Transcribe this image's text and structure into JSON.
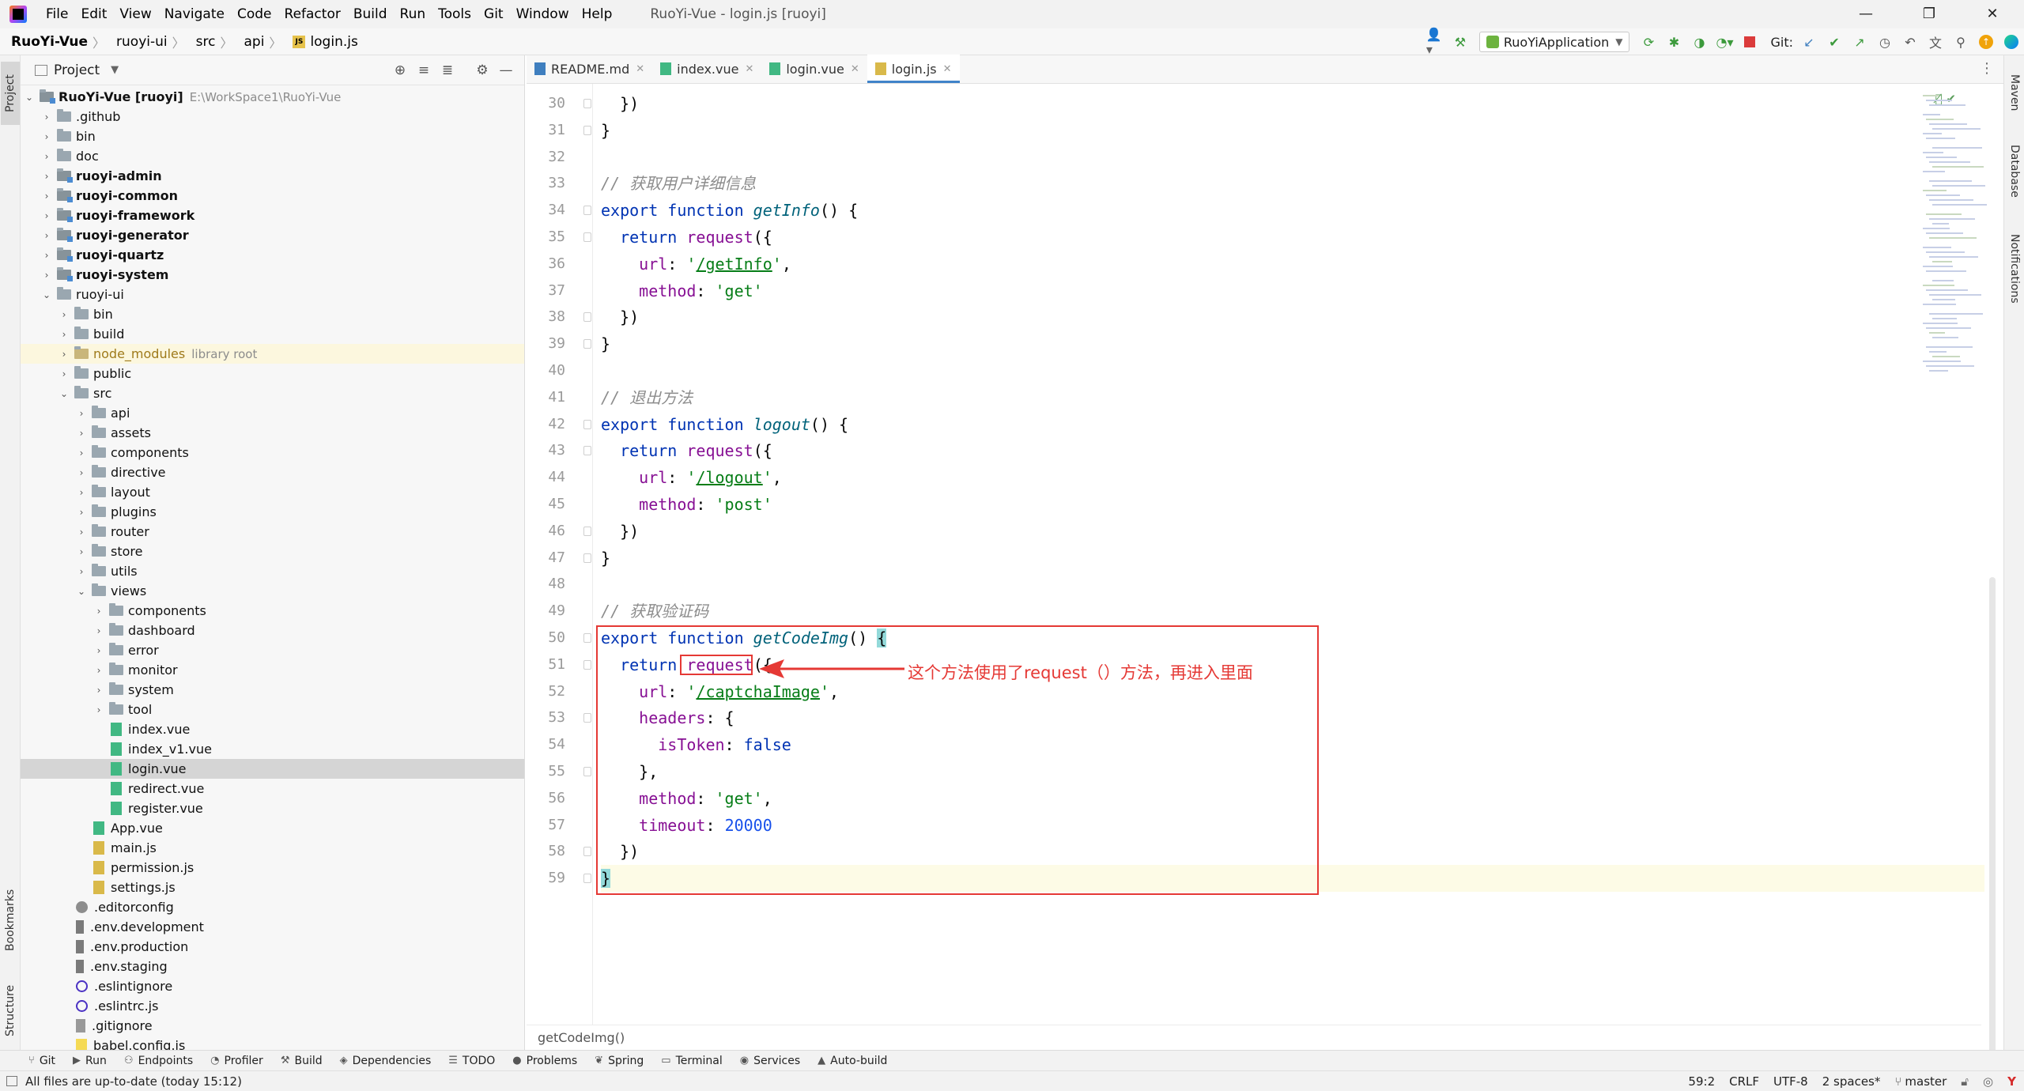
{
  "window": {
    "title": "RuoYi-Vue - login.js [ruoyi]",
    "menu": [
      "File",
      "Edit",
      "View",
      "Navigate",
      "Code",
      "Refactor",
      "Build",
      "Run",
      "Tools",
      "Git",
      "Window",
      "Help"
    ],
    "controls": {
      "minimize": "—",
      "restore": "❐",
      "close": "✕"
    }
  },
  "breadcrumb": [
    "RuoYi-Vue",
    "ruoyi-ui",
    "src",
    "api",
    "login.js"
  ],
  "toolbar": {
    "run_config": "RuoYiApplication",
    "git_label": "Git:"
  },
  "project_panel": {
    "title": "Project",
    "root": {
      "label": "RuoYi-Vue [ruoyi]",
      "path": "E:\\WorkSpace1\\RuoYi-Vue"
    },
    "items": [
      {
        "label": ".github",
        "kind": "folder",
        "depth": 1,
        "arrow": "›"
      },
      {
        "label": "bin",
        "kind": "folder",
        "depth": 1,
        "arrow": "›"
      },
      {
        "label": "doc",
        "kind": "folder",
        "depth": 1,
        "arrow": "›"
      },
      {
        "label": "ruoyi-admin",
        "kind": "module",
        "depth": 1,
        "arrow": "›"
      },
      {
        "label": "ruoyi-common",
        "kind": "module",
        "depth": 1,
        "arrow": "›"
      },
      {
        "label": "ruoyi-framework",
        "kind": "module",
        "depth": 1,
        "arrow": "›"
      },
      {
        "label": "ruoyi-generator",
        "kind": "module",
        "depth": 1,
        "arrow": "›"
      },
      {
        "label": "ruoyi-quartz",
        "kind": "module",
        "depth": 1,
        "arrow": "›"
      },
      {
        "label": "ruoyi-system",
        "kind": "module",
        "depth": 1,
        "arrow": "›"
      },
      {
        "label": "ruoyi-ui",
        "kind": "folder",
        "depth": 1,
        "arrow": "⌄"
      },
      {
        "label": "bin",
        "kind": "folder",
        "depth": 2,
        "arrow": "›"
      },
      {
        "label": "build",
        "kind": "folder",
        "depth": 2,
        "arrow": "›"
      },
      {
        "label": "node_modules",
        "kind": "excluded",
        "depth": 2,
        "arrow": "›",
        "hint": "library root"
      },
      {
        "label": "public",
        "kind": "folder",
        "depth": 2,
        "arrow": "›"
      },
      {
        "label": "src",
        "kind": "folder",
        "depth": 2,
        "arrow": "⌄"
      },
      {
        "label": "api",
        "kind": "folder",
        "depth": 3,
        "arrow": "›"
      },
      {
        "label": "assets",
        "kind": "folder",
        "depth": 3,
        "arrow": "›"
      },
      {
        "label": "components",
        "kind": "folder",
        "depth": 3,
        "arrow": "›"
      },
      {
        "label": "directive",
        "kind": "folder",
        "depth": 3,
        "arrow": "›"
      },
      {
        "label": "layout",
        "kind": "folder",
        "depth": 3,
        "arrow": "›"
      },
      {
        "label": "plugins",
        "kind": "folder",
        "depth": 3,
        "arrow": "›"
      },
      {
        "label": "router",
        "kind": "folder",
        "depth": 3,
        "arrow": "›"
      },
      {
        "label": "store",
        "kind": "folder",
        "depth": 3,
        "arrow": "›"
      },
      {
        "label": "utils",
        "kind": "folder",
        "depth": 3,
        "arrow": "›"
      },
      {
        "label": "views",
        "kind": "folder",
        "depth": 3,
        "arrow": "⌄"
      },
      {
        "label": "components",
        "kind": "folder",
        "depth": 4,
        "arrow": "›"
      },
      {
        "label": "dashboard",
        "kind": "folder",
        "depth": 4,
        "arrow": "›"
      },
      {
        "label": "error",
        "kind": "folder",
        "depth": 4,
        "arrow": "›"
      },
      {
        "label": "monitor",
        "kind": "folder",
        "depth": 4,
        "arrow": "›"
      },
      {
        "label": "system",
        "kind": "folder",
        "depth": 4,
        "arrow": "›"
      },
      {
        "label": "tool",
        "kind": "folder",
        "depth": 4,
        "arrow": "›"
      },
      {
        "label": "index.vue",
        "kind": "vue",
        "depth": 4
      },
      {
        "label": "index_v1.vue",
        "kind": "vue",
        "depth": 4
      },
      {
        "label": "login.vue",
        "kind": "vue",
        "depth": 4,
        "selected": true
      },
      {
        "label": "redirect.vue",
        "kind": "vue",
        "depth": 4
      },
      {
        "label": "register.vue",
        "kind": "vue",
        "depth": 4
      },
      {
        "label": "App.vue",
        "kind": "vue",
        "depth": 3
      },
      {
        "label": "main.js",
        "kind": "js",
        "depth": 3
      },
      {
        "label": "permission.js",
        "kind": "js",
        "depth": 3
      },
      {
        "label": "settings.js",
        "kind": "js",
        "depth": 3
      },
      {
        "label": ".editorconfig",
        "kind": "cfg",
        "depth": 2
      },
      {
        "label": ".env.development",
        "kind": "env",
        "depth": 2
      },
      {
        "label": ".env.production",
        "kind": "env",
        "depth": 2
      },
      {
        "label": ".env.staging",
        "kind": "env",
        "depth": 2
      },
      {
        "label": ".eslintignore",
        "kind": "eslint",
        "depth": 2
      },
      {
        "label": ".eslintrc.js",
        "kind": "eslint",
        "depth": 2
      },
      {
        "label": ".gitignore",
        "kind": "git",
        "depth": 2
      },
      {
        "label": "babel.config.js",
        "kind": "babel",
        "depth": 2
      }
    ]
  },
  "side_tabs": {
    "project": "Project",
    "bookmarks": "Bookmarks",
    "structure": "Structure",
    "maven": "Maven",
    "database": "Database",
    "notifications": "Notifications"
  },
  "tabs": [
    {
      "label": "README.md",
      "icon": "md"
    },
    {
      "label": "index.vue",
      "icon": "vue"
    },
    {
      "label": "login.vue",
      "icon": "vue"
    },
    {
      "label": "login.js",
      "icon": "js",
      "active": true
    }
  ],
  "code_lines": [
    {
      "n": "30",
      "html": "  })"
    },
    {
      "n": "31",
      "html": "}"
    },
    {
      "n": "32",
      "html": ""
    },
    {
      "n": "33",
      "html": "<span class=\"cmt\">// 获取用户详细信息</span>"
    },
    {
      "n": "34",
      "html": "<span class=\"kw\">export function</span> <span class=\"fn\">getInfo</span>() {"
    },
    {
      "n": "35",
      "html": "  <span class=\"kw\">return</span> <span class=\"prop\">request</span>({"
    },
    {
      "n": "36",
      "html": "    <span class=\"prop\">url</span>: <span class=\"str\">'</span><span class=\"strlink\">/getInfo</span><span class=\"str\">'</span>,"
    },
    {
      "n": "37",
      "html": "    <span class=\"prop\">method</span>: <span class=\"str\">'get'</span>"
    },
    {
      "n": "38",
      "html": "  })"
    },
    {
      "n": "39",
      "html": "}"
    },
    {
      "n": "40",
      "html": ""
    },
    {
      "n": "41",
      "html": "<span class=\"cmt\">// 退出方法</span>"
    },
    {
      "n": "42",
      "html": "<span class=\"kw\">export function</span> <span class=\"fn\">logout</span>() {"
    },
    {
      "n": "43",
      "html": "  <span class=\"kw\">return</span> <span class=\"prop\">request</span>({"
    },
    {
      "n": "44",
      "html": "    <span class=\"prop\">url</span>: <span class=\"str\">'</span><span class=\"strlink\">/logout</span><span class=\"str\">'</span>,"
    },
    {
      "n": "45",
      "html": "    <span class=\"prop\">method</span>: <span class=\"str\">'post'</span>"
    },
    {
      "n": "46",
      "html": "  })"
    },
    {
      "n": "47",
      "html": "}"
    },
    {
      "n": "48",
      "html": ""
    },
    {
      "n": "49",
      "html": "<span class=\"cmt\">// 获取验证码</span>"
    },
    {
      "n": "50",
      "html": "<span class=\"kw\">export function</span> <span class=\"fn\">getCodeImg</span>() <span class=\"brace-hl\">{</span>"
    },
    {
      "n": "51",
      "html": "  <span class=\"kw\">return</span> <span class=\"prop\">request</span>({"
    },
    {
      "n": "52",
      "html": "    <span class=\"prop\">url</span>: <span class=\"str\">'</span><span class=\"strlink\">/captchaImage</span><span class=\"str\">'</span>,"
    },
    {
      "n": "53",
      "html": "    <span class=\"prop\">headers</span>: {"
    },
    {
      "n": "54",
      "html": "      <span class=\"prop\">isToken</span>: <span class=\"kw\">false</span>"
    },
    {
      "n": "55",
      "html": "    },"
    },
    {
      "n": "56",
      "html": "    <span class=\"prop\">method</span>: <span class=\"str\">'get'</span>,"
    },
    {
      "n": "57",
      "html": "    <span class=\"prop\">timeout</span>: <span class=\"num\">20000</span>"
    },
    {
      "n": "58",
      "html": "  })"
    },
    {
      "n": "59",
      "html": "<span class=\"brace-hl\">}</span>",
      "caret": true
    }
  ],
  "editor_breadcrumb": "getCodeImg()",
  "annotation": {
    "text": "这个方法使用了request（）方法，再进入里面",
    "color": "#e53935"
  },
  "tool_windows": [
    {
      "label": "Git",
      "icon": "⑂"
    },
    {
      "label": "Run",
      "icon": "▶"
    },
    {
      "label": "Endpoints",
      "icon": "⚇"
    },
    {
      "label": "Profiler",
      "icon": "◔"
    },
    {
      "label": "Build",
      "icon": "⚒"
    },
    {
      "label": "Dependencies",
      "icon": "◈"
    },
    {
      "label": "TODO",
      "icon": "☰"
    },
    {
      "label": "Problems",
      "icon": "●"
    },
    {
      "label": "Spring",
      "icon": "❦"
    },
    {
      "label": "Terminal",
      "icon": "▭"
    },
    {
      "label": "Services",
      "icon": "◉"
    },
    {
      "label": "Auto-build",
      "icon": "▲"
    }
  ],
  "status": {
    "message": "All files are up-to-date (today 15:12)",
    "position": "59:2",
    "line_sep": "CRLF",
    "encoding": "UTF-8",
    "indent": "2 spaces*",
    "branch": "master"
  }
}
